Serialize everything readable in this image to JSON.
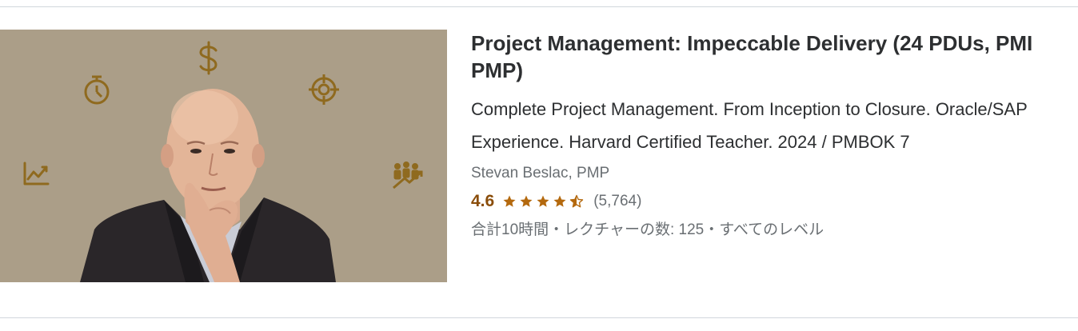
{
  "course": {
    "title": "Project Management: Impeccable Delivery (24 PDUs, PMI PMP)",
    "headline": "Complete Project Management. From Inception to Closure. Oracle/SAP Experience. Harvard Certified Teacher. 2024 / PMBOK 7",
    "instructor": "Stevan Beslac, PMP",
    "rating": "4.6",
    "rating_value": 4.6,
    "rating_count": "(5,764)",
    "meta": "合計10時間・レクチャーの数: 125・すべてのレベル",
    "thumbnail_icons": [
      "dollar-icon",
      "stopwatch-icon",
      "target-icon",
      "chart-icon",
      "team-growth-icon"
    ]
  },
  "colors": {
    "rating": "#8a4d0a",
    "star": "#b4690e",
    "thumbnail_bg": "#a89a85",
    "icon_gold": "#8f6a1f"
  }
}
